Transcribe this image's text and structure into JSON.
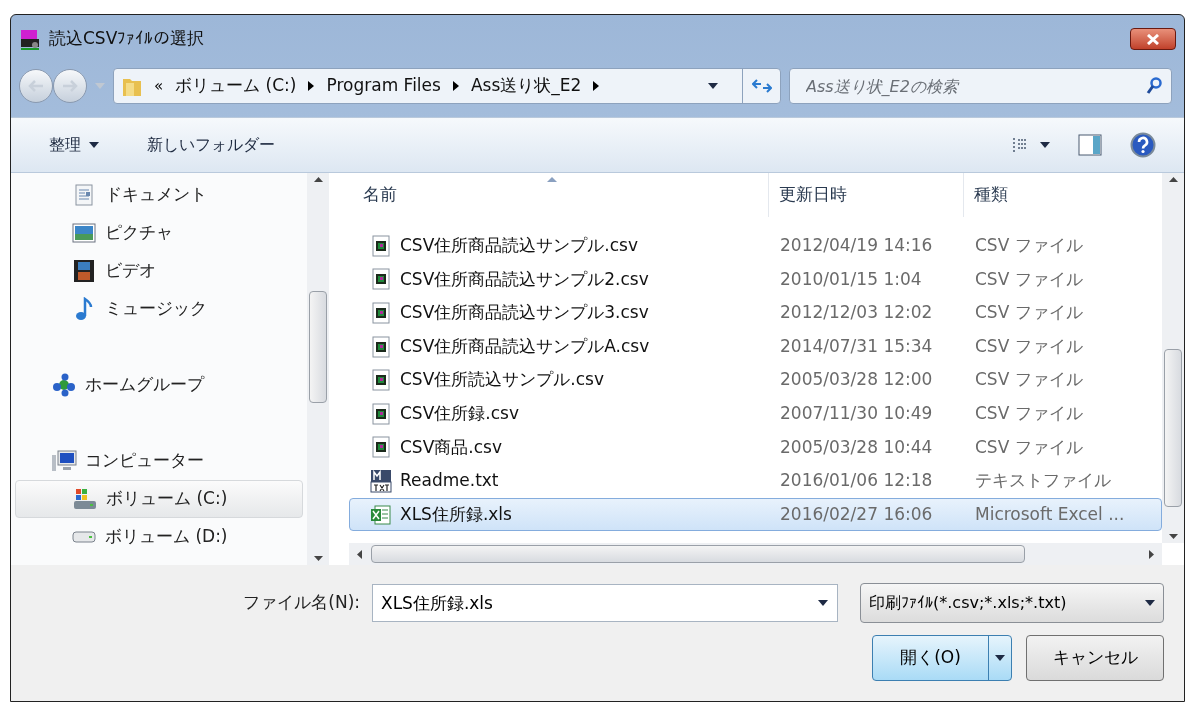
{
  "window": {
    "title": "読込CSVﾌｧｲﾙの選択"
  },
  "breadcrumb": {
    "overflow": "«",
    "parts": [
      "ボリューム (C:)",
      "Program Files",
      "Ass送り状_E2"
    ]
  },
  "search": {
    "placeholder": "Ass送り状_E2の検索"
  },
  "toolbar": {
    "organize": "整理",
    "new_folder": "新しいフォルダー"
  },
  "sidebar": {
    "items": [
      {
        "label": "ドキュメント",
        "kind": "document",
        "indent": true,
        "selected": false
      },
      {
        "label": "ピクチャ",
        "kind": "picture",
        "indent": true,
        "selected": false
      },
      {
        "label": "ビデオ",
        "kind": "video",
        "indent": true,
        "selected": false
      },
      {
        "label": "ミュージック",
        "kind": "music",
        "indent": true,
        "selected": false
      },
      {
        "label": "ホームグループ",
        "kind": "homegroup",
        "indent": false,
        "selected": false
      },
      {
        "label": "コンピューター",
        "kind": "computer",
        "indent": false,
        "selected": false
      },
      {
        "label": "ボリューム (C:)",
        "kind": "system-drive",
        "indent": true,
        "selected": true
      },
      {
        "label": "ボリューム (D:)",
        "kind": "drive",
        "indent": true,
        "selected": false
      }
    ]
  },
  "table": {
    "columns": [
      "名前",
      "更新日時",
      "種類"
    ],
    "rows": [
      {
        "name": "CSV住所商品読込サンプル.csv",
        "date": "2012/04/19 14:16",
        "type": "CSV ファイル",
        "kind": "csv",
        "selected": false
      },
      {
        "name": "CSV住所商品読込サンプル2.csv",
        "date": "2010/01/15 1:04",
        "type": "CSV ファイル",
        "kind": "csv",
        "selected": false
      },
      {
        "name": "CSV住所商品読込サンプル3.csv",
        "date": "2012/12/03 12:02",
        "type": "CSV ファイル",
        "kind": "csv",
        "selected": false
      },
      {
        "name": "CSV住所商品読込サンプルA.csv",
        "date": "2014/07/31 15:34",
        "type": "CSV ファイル",
        "kind": "csv",
        "selected": false
      },
      {
        "name": "CSV住所読込サンプル.csv",
        "date": "2005/03/28 12:00",
        "type": "CSV ファイル",
        "kind": "csv",
        "selected": false
      },
      {
        "name": "CSV住所録.csv",
        "date": "2007/11/30 10:49",
        "type": "CSV ファイル",
        "kind": "csv",
        "selected": false
      },
      {
        "name": "CSV商品.csv",
        "date": "2005/03/28 10:44",
        "type": "CSV ファイル",
        "kind": "csv",
        "selected": false
      },
      {
        "name": "Readme.txt",
        "date": "2016/01/06 12:18",
        "type": "テキストファイル",
        "kind": "txt",
        "selected": false
      },
      {
        "name": "XLS住所録.xls",
        "date": "2016/02/27 16:06",
        "type": "Microsoft Excel ...",
        "kind": "xls",
        "selected": true
      }
    ]
  },
  "footer": {
    "filename_label": "ファイル名(N):",
    "filename": "XLS住所録.xls",
    "filter": "印刷ﾌｧｲﾙ(*.csv;*.xls;*.txt)",
    "open": "開く(O)",
    "cancel": "キャンセル"
  }
}
